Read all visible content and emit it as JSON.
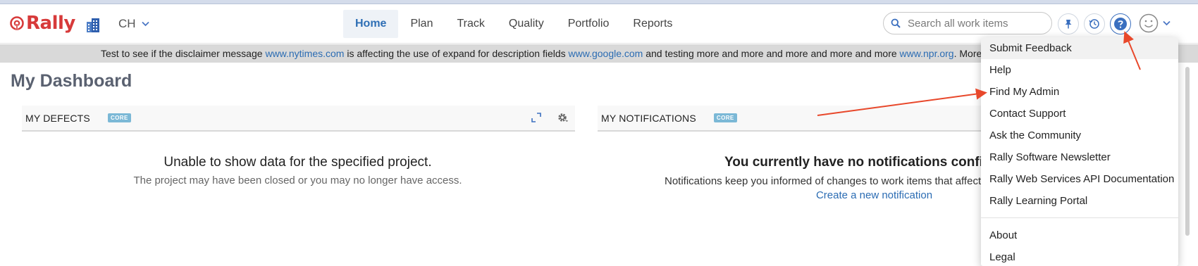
{
  "app": {
    "name": "Rally",
    "workspace": "CH"
  },
  "nav": {
    "tabs": [
      {
        "label": "Home",
        "active": true
      },
      {
        "label": "Plan",
        "active": false
      },
      {
        "label": "Track",
        "active": false
      },
      {
        "label": "Quality",
        "active": false
      },
      {
        "label": "Portfolio",
        "active": false
      },
      {
        "label": "Reports",
        "active": false
      }
    ],
    "search_placeholder": "Search all work items"
  },
  "disclaimer": {
    "t1": "Test to see if the disclaimer message ",
    "l1": "www.nytimes.com",
    "t2": " is affecting the use of expand for description fields ",
    "l2": "www.google.com",
    "t3": " and testing more and more and more and more and more ",
    "l3": "www.npr.org",
    "t4": ". More text"
  },
  "page_title": "My Dashboard",
  "panels": {
    "defects": {
      "title": "MY DEFECTS",
      "badge": "CORE",
      "message": "Unable to show data for the specified project.",
      "sub": "The project may have been closed or you may no longer have access."
    },
    "notifications": {
      "title": "MY NOTIFICATIONS",
      "badge": "CORE",
      "message": "You currently have no notifications configured.",
      "sub": "Notifications keep you informed of changes to work items that affect work in your projects.",
      "link": "Create a new notification"
    }
  },
  "help_menu": {
    "items": [
      "Submit Feedback",
      "Help",
      "Find My Admin",
      "Contact Support",
      "Ask the Community",
      "Rally Software Newsletter",
      "Rally Web Services API Documentation",
      "Rally Learning Portal"
    ],
    "items_bottom": [
      "About",
      "Legal"
    ]
  },
  "colors": {
    "brand": "#d73a3a",
    "link": "#2b6cb3",
    "active_tab": "#2f6fb5",
    "annotation_arrow": "#e8482b"
  },
  "icons": [
    "rally-logo-icon",
    "building-icon",
    "chevron-down-icon",
    "search-icon",
    "pin-icon",
    "history-icon",
    "help-icon",
    "smiley-avatar-icon",
    "expand-icon",
    "gear-icon"
  ]
}
